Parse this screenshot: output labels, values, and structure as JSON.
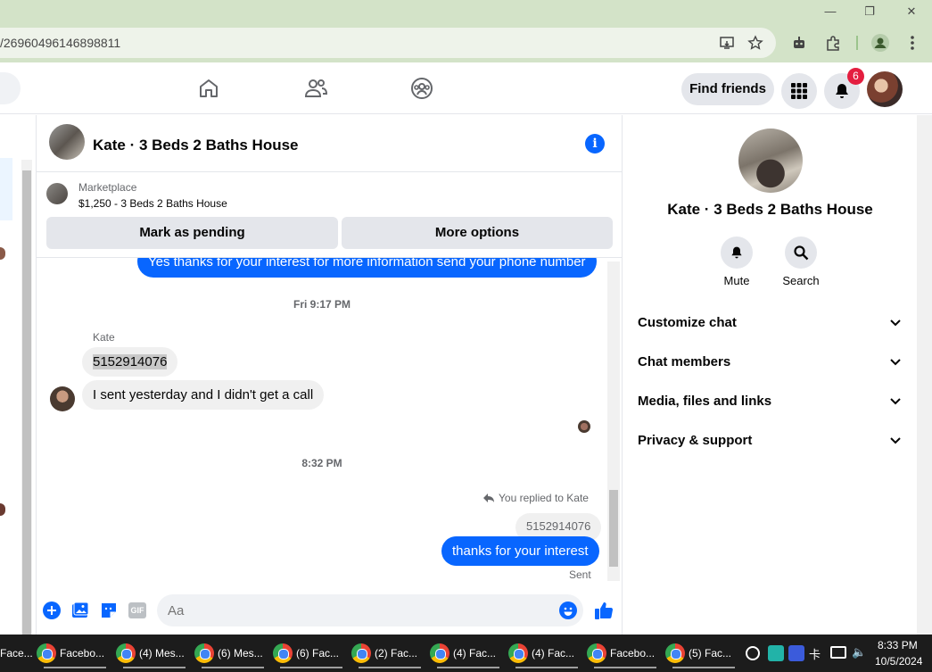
{
  "browser": {
    "url": "/26960496146898811",
    "controls": {
      "minimize": "—",
      "restore": "❐",
      "close": "✕"
    },
    "icons": [
      "cast-icon",
      "star-icon",
      "robot-extension-icon",
      "puzzle-extensions-icon",
      "profile-icon",
      "menu-kebab-icon"
    ]
  },
  "fb_nav": {
    "find_friends": "Find friends",
    "notifications_count": "6",
    "icons": [
      "home-icon",
      "friends-icon",
      "groups-icon",
      "menu-grid-icon",
      "bell-icon"
    ]
  },
  "chat": {
    "title": "Kate · 3 Beds 2 Baths House",
    "listing": {
      "source": "Marketplace",
      "price_title": "$1,250 - 3 Beds 2 Baths House",
      "mark_pending": "Mark as pending",
      "more_options": "More options"
    },
    "messages": {
      "out_1": "Yes thanks for your interest for more information send your phone number",
      "time_1": "Fri 9:17 PM",
      "sender": "Kate",
      "in_1": "5152914076",
      "in_2": "I sent yesterday and I didn't get a call",
      "time_2": "8:32 PM",
      "replied_label": "You replied to Kate",
      "quoted": "5152914076",
      "out_2": "thanks for your interest",
      "status": "Sent"
    },
    "composer": {
      "placeholder": "Aa",
      "gif_label": "GIF"
    }
  },
  "right_panel": {
    "name": "Kate · 3 Beds 2 Baths House",
    "mute": "Mute",
    "search": "Search",
    "rows": [
      "Customize chat",
      "Chat members",
      "Media, files and links",
      "Privacy & support"
    ]
  },
  "taskbar": {
    "tasks": [
      "Face...",
      "Facebo...",
      "(4) Mes...",
      "(6) Mes...",
      "(6) Fac...",
      "(2) Fac...",
      "(4) Fac...",
      "(4) Fac...",
      "Facebo...",
      "(5) Fac..."
    ],
    "time": "8:33 PM",
    "date": "10/5/2024"
  },
  "colors": {
    "messenger_blue": "#0866ff",
    "badge_red": "#e41e3f",
    "chrome_green": "#d3e3c8"
  }
}
